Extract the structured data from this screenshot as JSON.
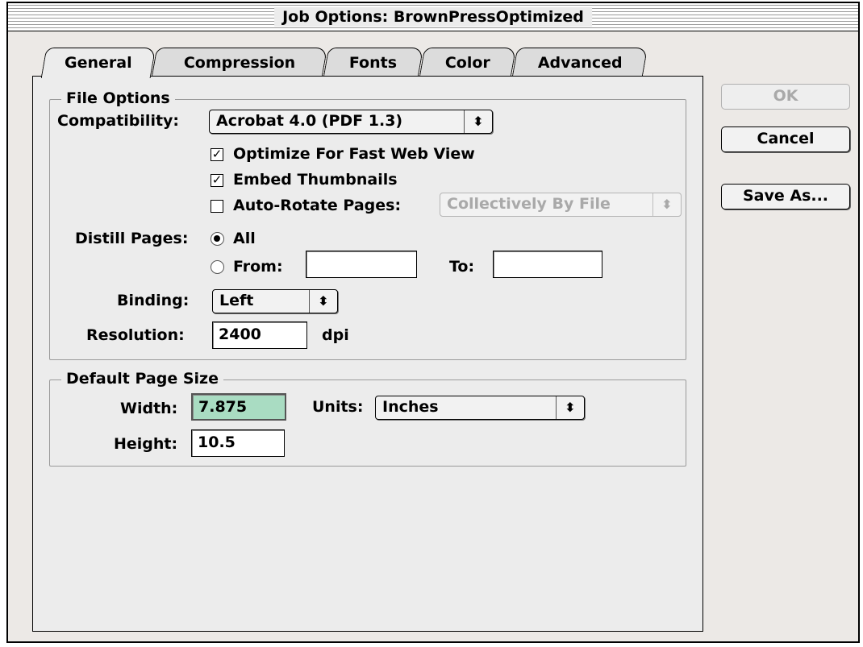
{
  "window": {
    "title": "Job Options: BrownPressOptimized"
  },
  "tabs": [
    {
      "label": "General",
      "active": true
    },
    {
      "label": "Compression",
      "active": false
    },
    {
      "label": "Fonts",
      "active": false
    },
    {
      "label": "Color",
      "active": false
    },
    {
      "label": "Advanced",
      "active": false
    }
  ],
  "buttons": {
    "ok": "OK",
    "cancel": "Cancel",
    "save_as": "Save As..."
  },
  "file_options": {
    "group_label": "File Options",
    "compatibility_label": "Compatibility:",
    "compatibility_value": "Acrobat 4.0 (PDF 1.3)",
    "optimize_label": "Optimize For Fast Web View",
    "optimize_checked": true,
    "thumbnails_label": "Embed Thumbnails",
    "thumbnails_checked": true,
    "autorotate_label": "Auto-Rotate Pages:",
    "autorotate_checked": false,
    "autorotate_value": "Collectively By File",
    "distill_label": "Distill Pages:",
    "all_label": "All",
    "all_selected": true,
    "from_label": "From:",
    "from_value": "",
    "to_label": "To:",
    "to_value": "",
    "binding_label": "Binding:",
    "binding_value": "Left",
    "resolution_label": "Resolution:",
    "resolution_value": "2400",
    "resolution_unit": "dpi"
  },
  "page_size": {
    "group_label": "Default Page Size",
    "width_label": "Width:",
    "width_value": "7.875",
    "height_label": "Height:",
    "height_value": "10.5",
    "units_label": "Units:",
    "units_value": "Inches"
  },
  "icons": {
    "checked": "checkmark-icon",
    "popup": "updown-arrows-icon"
  },
  "colors": {
    "highlight_field": "#a9dcc2",
    "dialog_bg": "#ececec"
  }
}
